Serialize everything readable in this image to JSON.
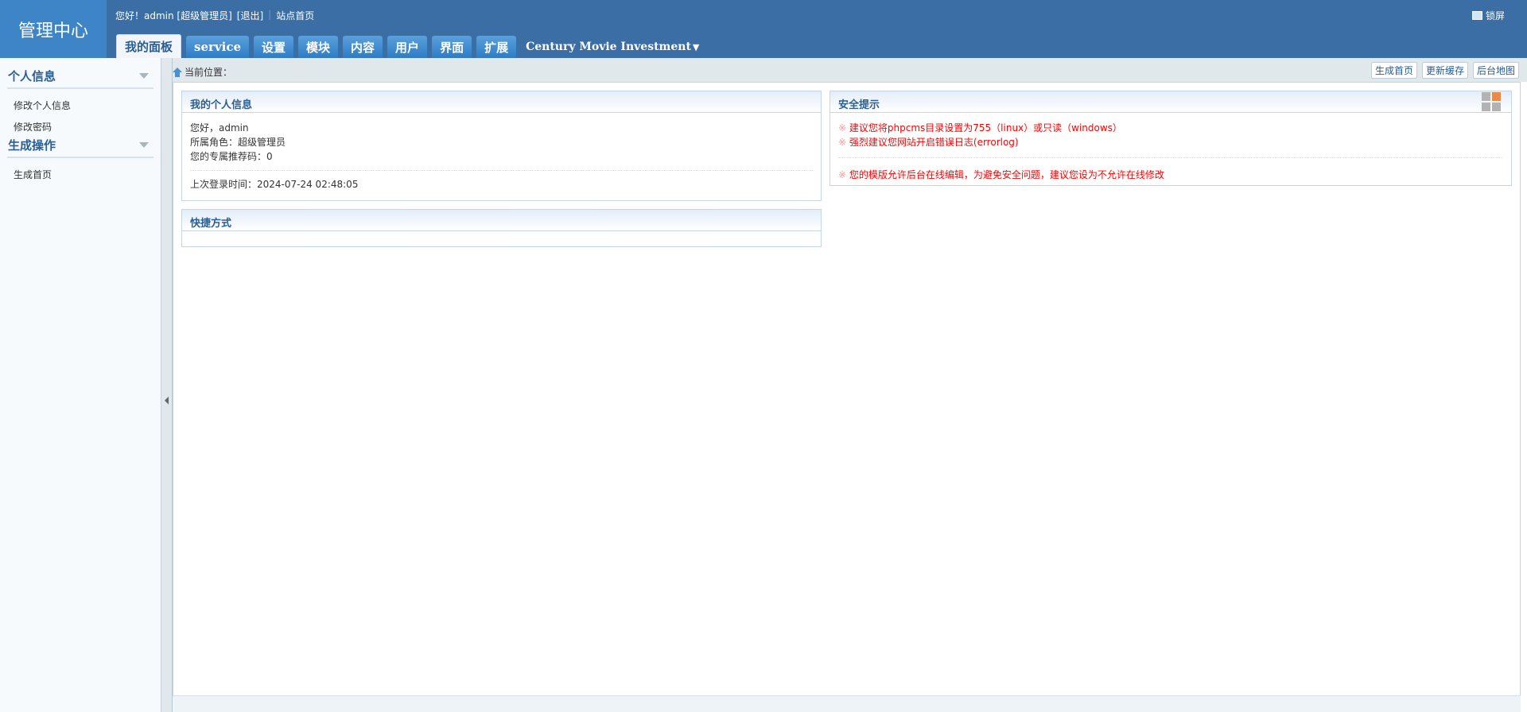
{
  "header": {
    "logo": "管理中心",
    "greeting": "您好！admin [超级管理员]",
    "logout": "[退出]",
    "site_home": "站点首页",
    "lock": "锁屏",
    "tabs": [
      "我的面板",
      "service",
      "设置",
      "模块",
      "内容",
      "用户",
      "界面",
      "扩展"
    ],
    "site_select": "Century Movie Investment"
  },
  "sidebar": {
    "groups": [
      {
        "title": "个人信息",
        "items": [
          "修改个人信息",
          "修改密码"
        ]
      },
      {
        "title": "生成操作",
        "items": [
          "生成首页"
        ]
      }
    ]
  },
  "breadcrumb": {
    "label": "当前位置："
  },
  "quick_buttons": [
    "生成首页",
    "更新缓存",
    "后台地图"
  ],
  "panels": {
    "personal": {
      "title": "我的个人信息",
      "hello": "您好，admin",
      "role": "所属角色：超级管理员",
      "ref_code": "您的专属推荐码：0",
      "last_login": "上次登录时间：2024-07-24 02:48:05"
    },
    "shortcuts": {
      "title": "快捷方式"
    },
    "security": {
      "title": "安全提示",
      "mark": "※",
      "tips": [
        "建议您将phpcms目录设置为755（linux）或只读（windows）",
        "强烈建议您网站开启错误日志(errorlog)"
      ],
      "tip2": "您的模版允许后台在线编辑，为避免安全问题，建议您设为不允许在线修改"
    }
  }
}
